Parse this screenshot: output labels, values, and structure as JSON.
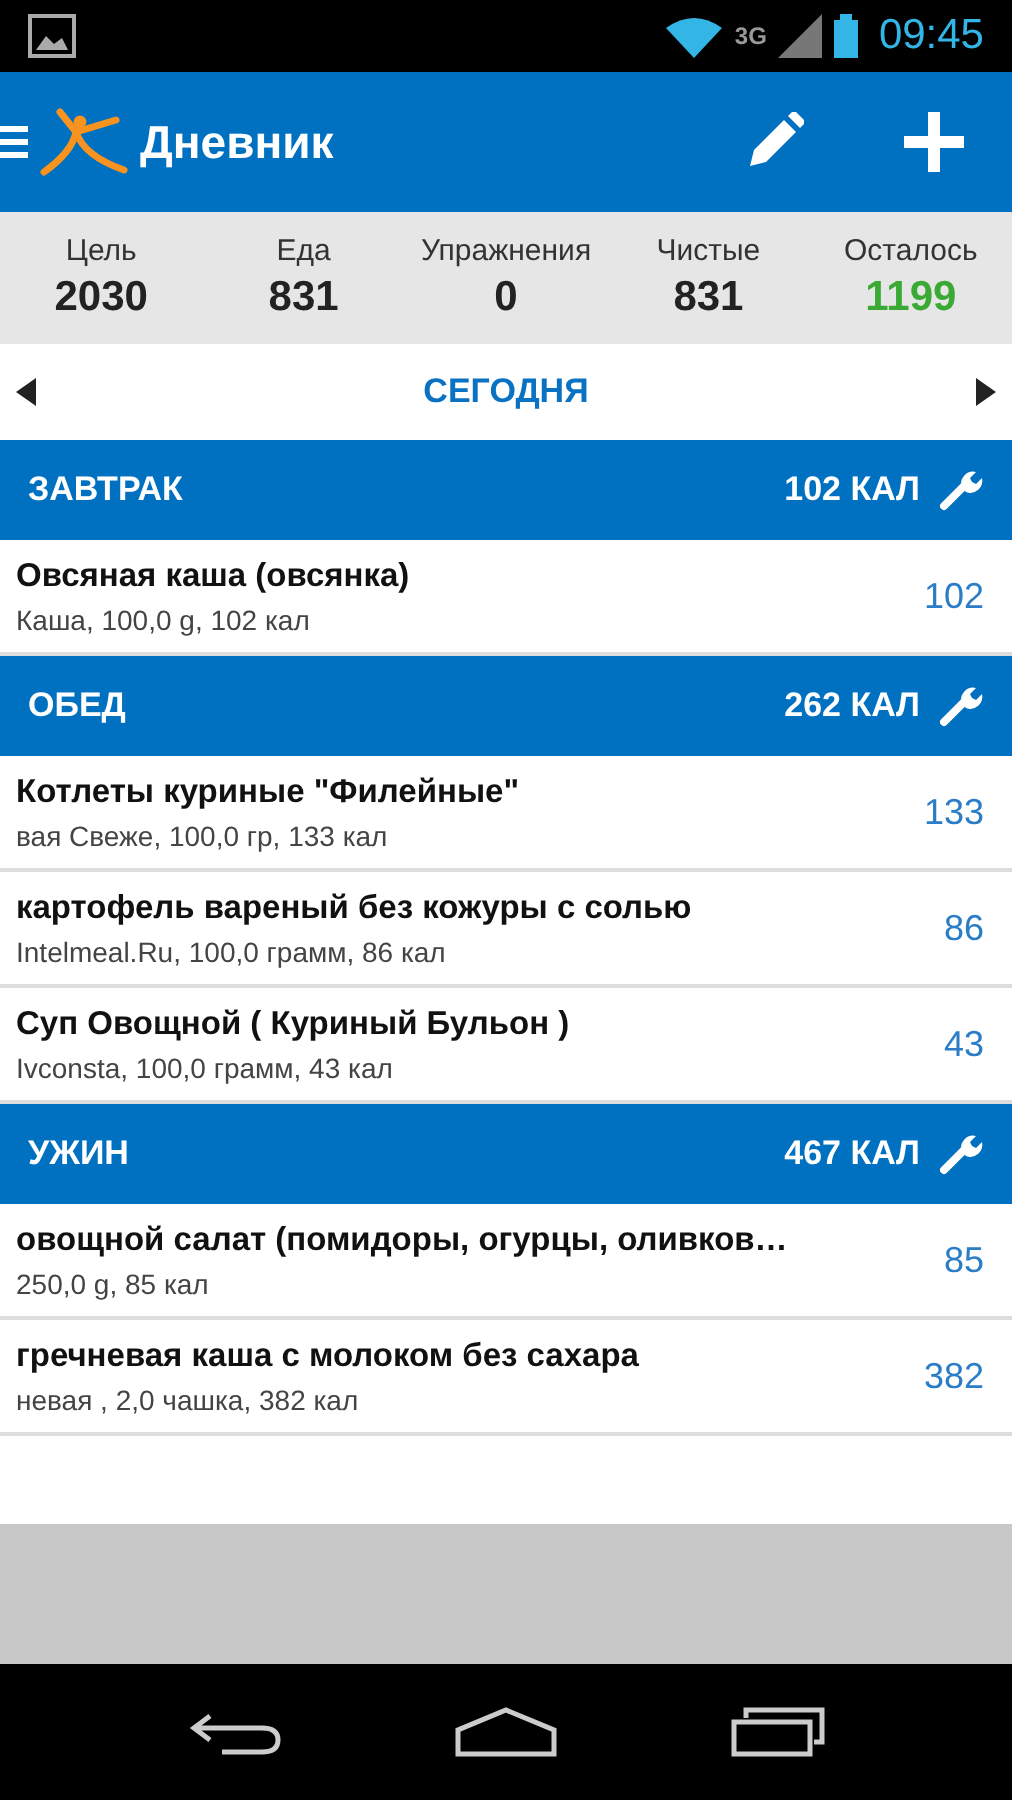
{
  "status_bar": {
    "time": "09:45",
    "network": "3G"
  },
  "app_bar": {
    "title": "Дневник"
  },
  "summary": [
    {
      "label": "Цель",
      "value": "2030",
      "highlight": false
    },
    {
      "label": "Еда",
      "value": "831",
      "highlight": false
    },
    {
      "label": "Упражнения",
      "value": "0",
      "highlight": false
    },
    {
      "label": "Чистые",
      "value": "831",
      "highlight": false
    },
    {
      "label": "Осталось",
      "value": "1199",
      "highlight": true
    }
  ],
  "date_nav": {
    "label": "СЕГОДНЯ"
  },
  "meals": [
    {
      "name": "ЗАВТРАК",
      "total": "102 КАЛ",
      "items": [
        {
          "title": "Овсяная каша (овсянка)",
          "detail": "Каша, 100,0 g, 102 кал",
          "calories": "102"
        }
      ]
    },
    {
      "name": "ОБЕД",
      "total": "262 КАЛ",
      "items": [
        {
          "title": "Котлеты куриные \"Филейные\"",
          "detail": "вая Свеже, 100,0 гр, 133 кал",
          "calories": "133"
        },
        {
          "title": "картофель вареный без кожуры с солью",
          "detail": "Intelmeal.Ru, 100,0 грамм, 86 кал",
          "calories": "86"
        },
        {
          "title": "Суп Овощной ( Куриный Бульон )",
          "detail": "Ivconsta, 100,0 грамм, 43 кал",
          "calories": "43"
        }
      ]
    },
    {
      "name": "УЖИН",
      "total": "467 КАЛ",
      "items": [
        {
          "title": "овощной салат (помидоры, огурцы, оливков…",
          "detail": "250,0 g, 85 кал",
          "calories": "85"
        },
        {
          "title": "гречневая каша с молоком без сахара",
          "detail": "невая , 2,0 чашка, 382 кал",
          "calories": "382"
        }
      ]
    }
  ]
}
